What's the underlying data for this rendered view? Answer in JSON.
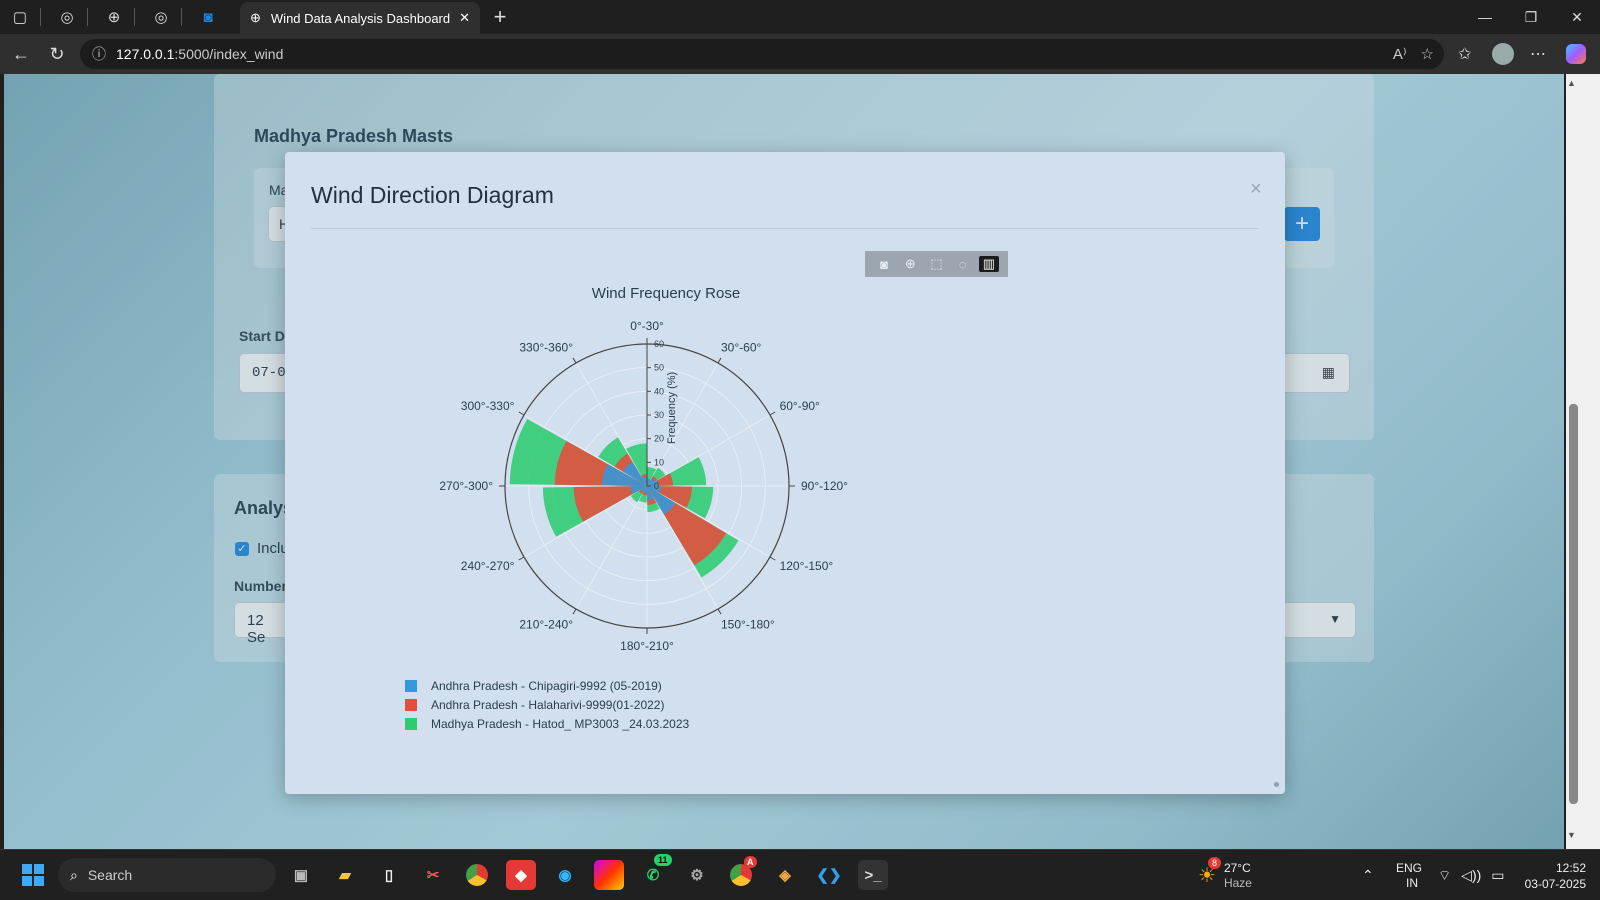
{
  "browser": {
    "tab_title": "Wind Data Analysis Dashboard",
    "url_host": "127.0.0.1",
    "url_path": ":5000/index_wind"
  },
  "page": {
    "masts_title": "Madhya Pradesh Masts",
    "mast_label_fragment": "Ma",
    "mast_input_fragment": "H",
    "start_date_label": "Start Da",
    "start_date_value": "07-0",
    "analysis_title": "Analys",
    "include_label": "Inclu",
    "number_label": "Number",
    "sectors_value": "12 Se"
  },
  "modal": {
    "title": "Wind Direction Diagram",
    "close_label": "×"
  },
  "chart_data": {
    "type": "barpolar",
    "title": "Wind Frequency Rose",
    "radial_axis_label": "Frequency (%)",
    "radial_range": [
      0,
      60
    ],
    "radial_ticks": [
      "0",
      "10",
      "20",
      "30",
      "40",
      "50",
      "60"
    ],
    "categories": [
      "0°-30°",
      "30°-60°",
      "60°-90°",
      "90°-120°",
      "120°-150°",
      "150°-180°",
      "180°-210°",
      "210°-240°",
      "240°-270°",
      "270°-300°",
      "300°-330°",
      "330°-360°"
    ],
    "series": [
      {
        "name": "Andhra Pradesh - Chipagiri-9992 (05-2019)",
        "color": "#3498db",
        "values": [
          3,
          4,
          5,
          6,
          14,
          6,
          3,
          3,
          7,
          19,
          12,
          4
        ]
      },
      {
        "name": "Andhra Pradesh - Halaharivi-9999(01-2022)",
        "color": "#e74c3c",
        "values": [
          3,
          5,
          11,
          19,
          39,
          8,
          4,
          4,
          31,
          39,
          16,
          5
        ]
      },
      {
        "name": "Madhya Pradesh - Hatod_ MP3003 _24.03.2023",
        "color": "#2ecc71",
        "values": [
          8,
          9,
          25,
          28,
          45,
          11,
          7,
          8,
          44,
          58,
          24,
          18
        ]
      }
    ],
    "legend_position": "bottom-left"
  },
  "taskbar": {
    "search_label": "Search",
    "weather_temp": "27°C",
    "weather_desc": "Haze",
    "weather_badge": "8",
    "whatsapp_badge": "11",
    "chrome_badge": "A",
    "lang_line1": "ENG",
    "lang_line2": "IN",
    "time": "12:52",
    "date": "03-07-2025"
  }
}
